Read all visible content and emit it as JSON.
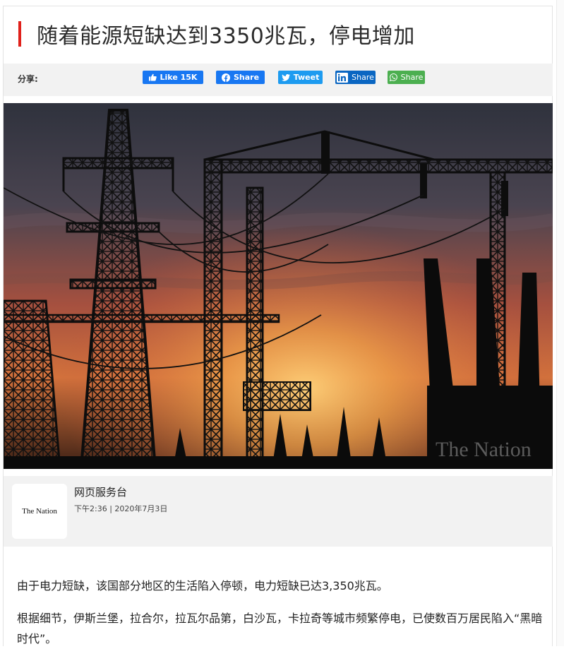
{
  "article": {
    "headline": "随着能源短缺达到3350兆瓦，停电增加"
  },
  "share_bar": {
    "label": "分享:",
    "facebook_like": "Like 15K",
    "facebook_share": "Share",
    "twitter": "Tweet",
    "linkedin": "Share",
    "whatsapp": "Share"
  },
  "photo": {
    "watermark": "The Nation",
    "sky_top": "#3a3d4a",
    "sky_mid": "#b8533a",
    "sky_glow": "#f0a14a"
  },
  "author": {
    "logo_text": "The Nation",
    "name": "网页服务台",
    "time": "下午2:36 | 2020年7月3日"
  },
  "body": {
    "paragraph_1": "由于电力短缺，该国部分地区的生活陷入停顿，电力短缺已达3,350兆瓦。",
    "paragraph_2": "根据细节，伊斯兰堡，拉合尔，拉瓦尔品第，白沙瓦，卡拉奇等城市频繁停电，已使数百万居民陷入“黑暗时代”。"
  },
  "colors": {
    "accent": "#e0211b",
    "facebook": "#1877f2",
    "twitter": "#1d9bf0",
    "linkedin": "#0a66c2",
    "whatsapp": "#4caf50"
  }
}
